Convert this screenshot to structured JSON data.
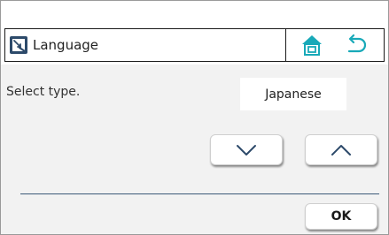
{
  "header": {
    "title": "Language",
    "title_icon": "language-setting-icon",
    "home_icon": "home-icon",
    "back_icon": "back-arrow-icon"
  },
  "main": {
    "prompt": "Select type.",
    "selected_value": "Japanese",
    "down_icon": "chevron-down-icon",
    "up_icon": "chevron-up-icon"
  },
  "footer": {
    "ok_label": "OK"
  },
  "colors": {
    "accent": "#18a9b8",
    "icon_dark": "#2d4a6a",
    "frame": "#1a1a1a"
  }
}
